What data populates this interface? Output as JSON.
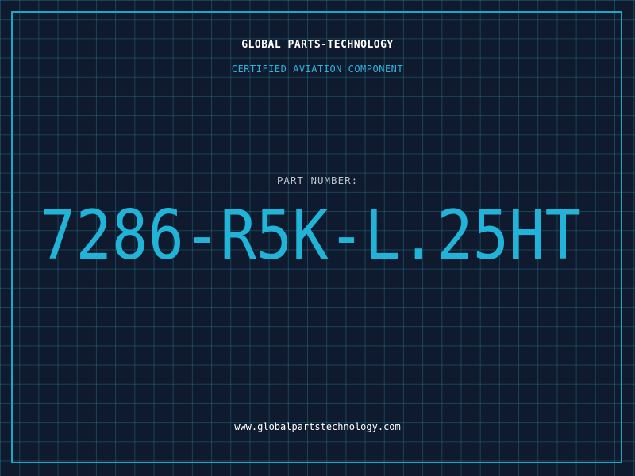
{
  "header": {
    "company": "GLOBAL PARTS-TECHNOLOGY",
    "tagline": "CERTIFIED AVIATION COMPONENT"
  },
  "part": {
    "label": "PART NUMBER:",
    "number": "7286-R5K-L.25HT"
  },
  "footer": {
    "website": "www.globalpartstechnology.com"
  },
  "colors": {
    "background": "#0f1a2e",
    "grid": "#1e788c",
    "frame": "#1aa8c8",
    "accent": "#2ab4e0",
    "part_number": "#22b4d8"
  }
}
